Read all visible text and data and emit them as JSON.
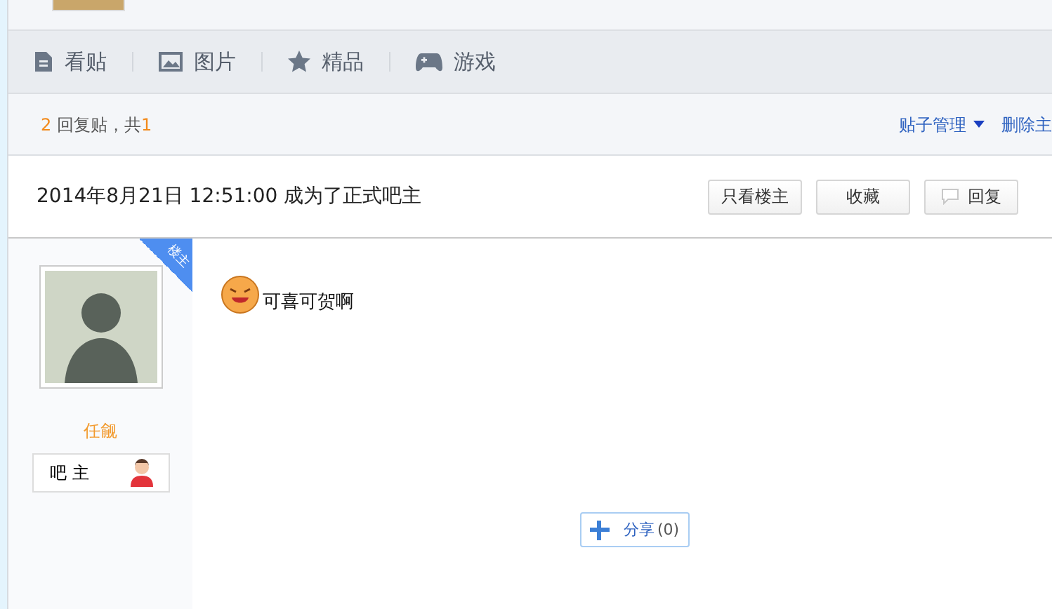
{
  "tabs": [
    {
      "label": "看贴",
      "kind": "doc"
    },
    {
      "label": "图片",
      "kind": "image"
    },
    {
      "label": "精品",
      "kind": "star"
    },
    {
      "label": "游戏",
      "kind": "gamepad"
    }
  ],
  "reply_info": {
    "count": "2",
    "label": "回复贴，共",
    "pages": "1"
  },
  "manage_links": [
    {
      "label": "贴子管理",
      "dropdown": true
    },
    {
      "label": "删除主",
      "dropdown": false
    }
  ],
  "post_title": "2014年8月21日 12:51:00 成为了正式吧主",
  "header_buttons": [
    {
      "label": "只看楼主",
      "icon": false
    },
    {
      "label": "收藏",
      "icon": false
    },
    {
      "label": "回复",
      "icon": true
    }
  ],
  "author": {
    "ribbon": "楼主",
    "name": "任觎",
    "role": "吧 主"
  },
  "post_text": "可喜可贺啊",
  "share": {
    "label": "分享",
    "count": "(0)"
  }
}
